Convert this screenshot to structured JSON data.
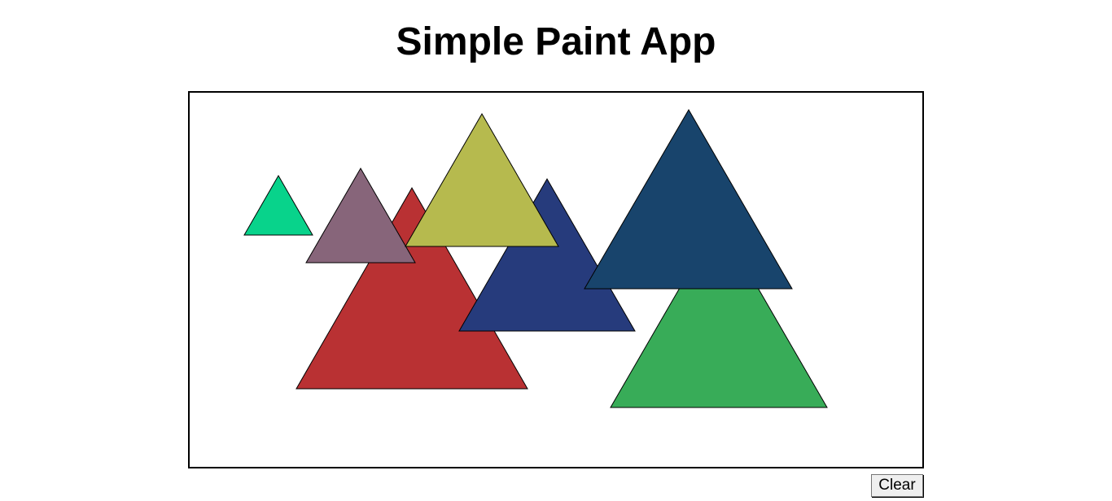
{
  "page": {
    "title": "Simple Paint App"
  },
  "toolbar": {
    "clear_label": "Clear"
  },
  "canvas": {
    "shapes": [
      {
        "kind": "triangle",
        "fill": "#08d38b",
        "stroke": "#000000"
      },
      {
        "kind": "triangle",
        "fill": "#b93133",
        "stroke": "#000000"
      },
      {
        "kind": "triangle",
        "fill": "#87657a",
        "stroke": "#000000"
      },
      {
        "kind": "triangle",
        "fill": "#263b7c",
        "stroke": "#000000"
      },
      {
        "kind": "triangle",
        "fill": "#b6ba4e",
        "stroke": "#000000"
      },
      {
        "kind": "triangle",
        "fill": "#38ac58",
        "stroke": "#000000"
      },
      {
        "kind": "triangle",
        "fill": "#18446c",
        "stroke": "#000000"
      }
    ]
  }
}
